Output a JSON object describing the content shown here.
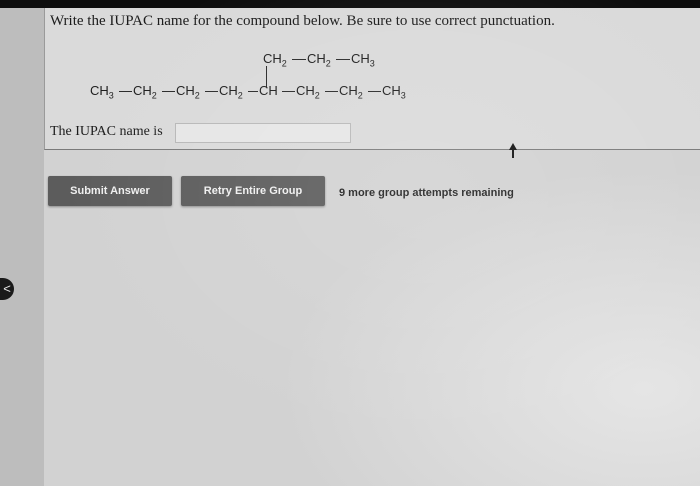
{
  "question": {
    "prompt": "Write the IUPAC name for the compound below. Be sure to use correct punctuation."
  },
  "structure": {
    "branch": [
      "CH2",
      "CH2",
      "CH3"
    ],
    "main_chain": [
      "CH3",
      "CH2",
      "CH2",
      "CH2",
      "CH",
      "CH2",
      "CH2",
      "CH3"
    ],
    "branch_point_index": 4
  },
  "answer": {
    "label": "The IUPAC name is",
    "value": "",
    "placeholder": ""
  },
  "actions": {
    "submit_label": "Submit Answer",
    "retry_label": "Retry Entire Group",
    "attempts_text": "9 more group attempts remaining"
  },
  "sidebar": {
    "collapse_label": "<"
  },
  "colors": {
    "background": "#d2d2d2",
    "button": "#5c5c5c",
    "button_text": "#f0f0f0"
  }
}
